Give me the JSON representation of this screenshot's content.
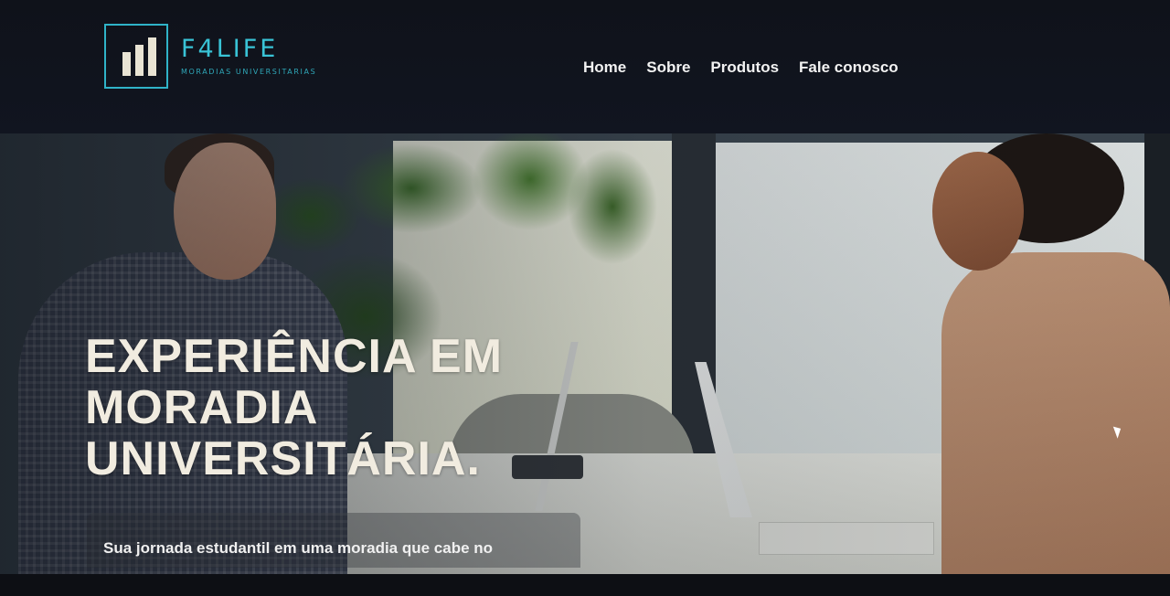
{
  "brand": {
    "name": "F4LIFE",
    "tagline": "MORADIAS UNIVERSITARIAS",
    "accent_color": "#39c3d6"
  },
  "nav": {
    "items": [
      {
        "label": "Home"
      },
      {
        "label": "Sobre"
      },
      {
        "label": "Produtos"
      },
      {
        "label": "Fale conosco"
      }
    ]
  },
  "hero": {
    "title_lines": [
      "EXPERIÊNCIA EM",
      "MORADIA",
      "UNIVERSITÁRIA."
    ],
    "subtitle": "Sua jornada estudantil em uma moradia que cabe no",
    "image": "hero-photo-two-students-at-table-with-laptops"
  },
  "icons": {
    "logo": "bar-chart-logo-icon",
    "cursor": "mouse-cursor-icon"
  }
}
